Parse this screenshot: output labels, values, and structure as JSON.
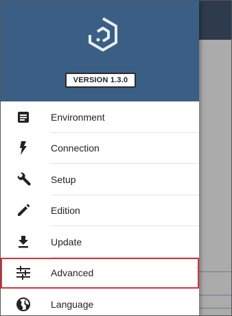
{
  "header": {
    "version_label": "VERSION 1.3.0"
  },
  "menu": {
    "items": [
      {
        "label": "Environment",
        "icon": "document-icon"
      },
      {
        "label": "Connection",
        "icon": "lightning-icon"
      },
      {
        "label": "Setup",
        "icon": "wrench-icon"
      },
      {
        "label": "Edition",
        "icon": "pencil-icon"
      },
      {
        "label": "Update",
        "icon": "download-icon"
      },
      {
        "label": "Advanced",
        "icon": "sliders-icon",
        "selected": true
      },
      {
        "label": "Language",
        "icon": "globe-icon"
      }
    ]
  },
  "colors": {
    "header_bg": "#3b5f84",
    "selection_outline": "#d7333a",
    "background_topbar": "#2d3b4d"
  }
}
